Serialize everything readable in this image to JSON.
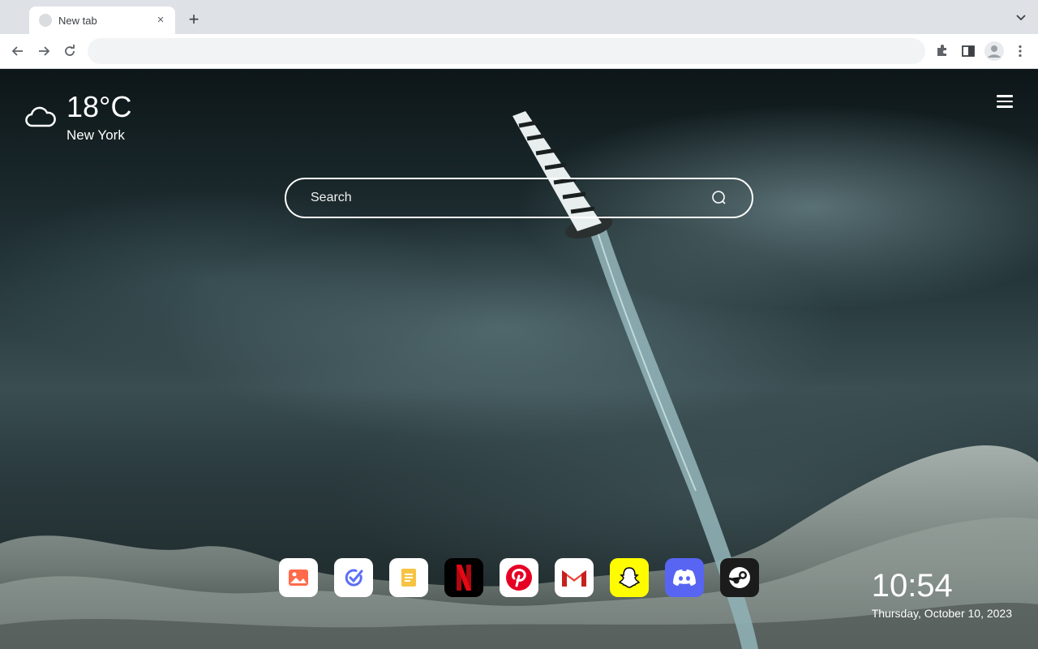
{
  "browser": {
    "tab_title": "New tab",
    "tab_close": "×",
    "new_tab": "+",
    "address": ""
  },
  "weather": {
    "temperature": "18°C",
    "city": "New York",
    "icon": "cloud-icon"
  },
  "search": {
    "placeholder": "Search"
  },
  "dock": {
    "apps": [
      {
        "name": "photos",
        "icon": "photos-icon",
        "color": "#ffffff"
      },
      {
        "name": "tasks",
        "icon": "tasks-icon",
        "color": "#ffffff"
      },
      {
        "name": "notes",
        "icon": "notes-icon",
        "color": "#ffffff"
      },
      {
        "name": "netflix",
        "icon": "netflix-icon",
        "color": "#000000"
      },
      {
        "name": "pinterest",
        "icon": "pinterest-icon",
        "color": "#ffffff"
      },
      {
        "name": "gmail",
        "icon": "gmail-icon",
        "color": "#ffffff"
      },
      {
        "name": "snapchat",
        "icon": "snapchat-icon",
        "color": "#fffc00"
      },
      {
        "name": "discord",
        "icon": "discord-icon",
        "color": "#5865f2"
      },
      {
        "name": "steam",
        "icon": "steam-icon",
        "color": "#1b1b1b"
      }
    ]
  },
  "clock": {
    "time": "10:54",
    "date": "Thursday, October 10, 2023"
  }
}
